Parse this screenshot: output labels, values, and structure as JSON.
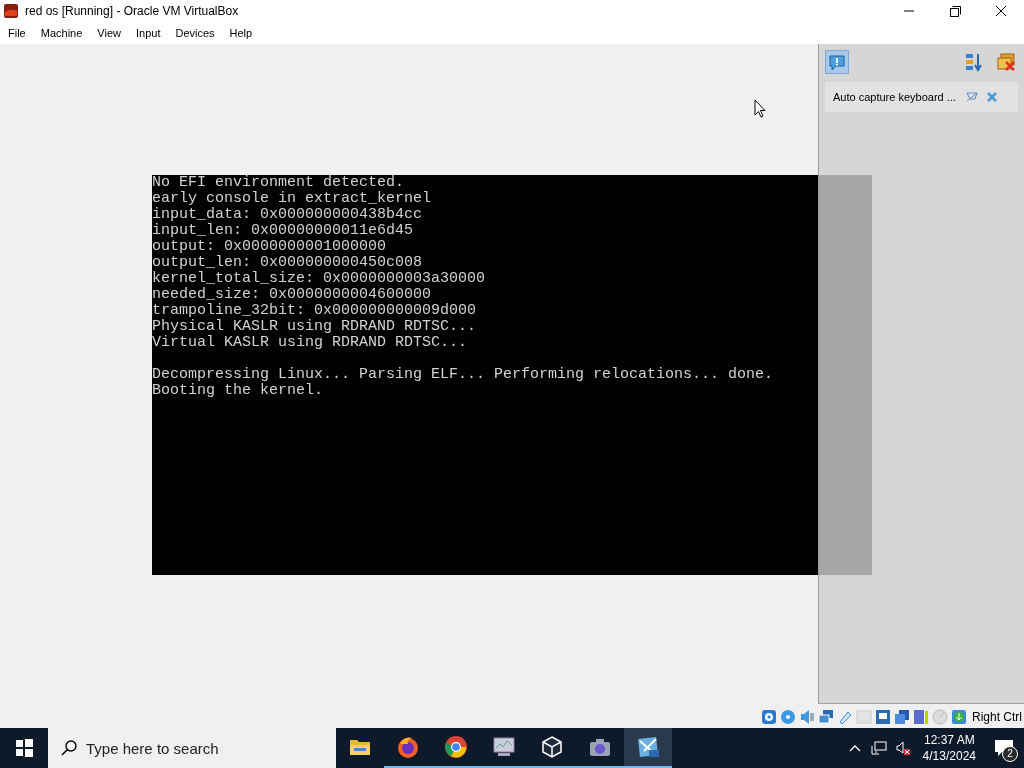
{
  "window": {
    "title": "red os [Running] - Oracle VM VirtualBox"
  },
  "menu": [
    "File",
    "Machine",
    "View",
    "Input",
    "Devices",
    "Help"
  ],
  "console": {
    "blocks": [
      [
        "No EFI environment detected.",
        "early console in extract_kernel",
        "input_data: 0x000000000438b4cc",
        "input_len: 0x00000000011e6d45",
        "output: 0x0000000001000000",
        "output_len: 0x000000000450c008",
        "kernel_total_size: 0x0000000003a30000",
        "needed_size: 0x0000000004600000",
        "trampoline_32bit: 0x000000000009d000",
        "Physical KASLR using RDRAND RDTSC...",
        "Virtual KASLR using RDRAND RDTSC..."
      ],
      [
        "Decompressing Linux... Parsing ELF... Performing relocations... done.",
        "Booting the kernel."
      ]
    ]
  },
  "notification_panel": {
    "center_selected": true,
    "items": [
      {
        "text": "Auto capture keyboard ..."
      }
    ]
  },
  "status_bar": {
    "host_key": "Right Ctrl"
  },
  "taskbar": {
    "search": {
      "placeholder": "Type here to search"
    },
    "apps": [
      {
        "kind": "folder",
        "running": false,
        "selected": false
      },
      {
        "kind": "firefox",
        "running": true,
        "selected": false
      },
      {
        "kind": "chrome",
        "running": true,
        "selected": false
      },
      {
        "kind": "monitor",
        "running": true,
        "selected": false
      },
      {
        "kind": "cube",
        "running": true,
        "selected": false
      },
      {
        "kind": "camera",
        "running": true,
        "selected": false
      },
      {
        "kind": "xp",
        "running": true,
        "selected": true
      }
    ],
    "time": "12:37 AM",
    "date": "4/13/2024",
    "notifications": "2"
  }
}
